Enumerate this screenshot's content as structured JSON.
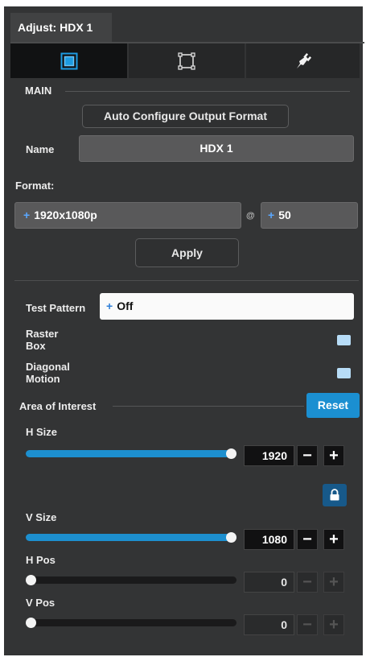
{
  "panel": {
    "tab_title": "Adjust: HDX 1"
  },
  "mode_tabs": [
    {
      "icon": "output-square-icon",
      "active": true
    },
    {
      "icon": "crop-frame-icon",
      "active": false
    },
    {
      "icon": "plug-icon",
      "active": false
    }
  ],
  "main": {
    "section_label": "MAIN",
    "auto_configure_label": "Auto Configure Output Format",
    "name_label": "Name",
    "name_value": "HDX 1",
    "format_label": "Format:",
    "resolution_value": "1920x1080p",
    "at_symbol": "@",
    "rate_value": "50",
    "apply_label": "Apply"
  },
  "test_pattern": {
    "label": "Test Pattern",
    "value": "Off",
    "raster_box_label_1": "Raster",
    "raster_box_label_2": "Box",
    "diagonal_motion_label_1": "Diagonal",
    "diagonal_motion_label_2": "Motion"
  },
  "aoi": {
    "title": "Area of Interest",
    "reset_label": "Reset",
    "h_size": {
      "label": "H Size",
      "value": "1920",
      "fraction": 1.0
    },
    "v_size": {
      "label": "V Size",
      "value": "1080",
      "fraction": 1.0
    },
    "h_pos": {
      "label": "H Pos",
      "value": "0",
      "fraction": 0.0
    },
    "v_pos": {
      "label": "V Pos",
      "value": "0",
      "fraction": 0.0
    },
    "minus": "−",
    "plus": "+",
    "lock_icon": "lock-icon"
  },
  "colors": {
    "accent": "#1b8fd1",
    "panel_bg": "#333435",
    "field_bg": "#59595a"
  }
}
